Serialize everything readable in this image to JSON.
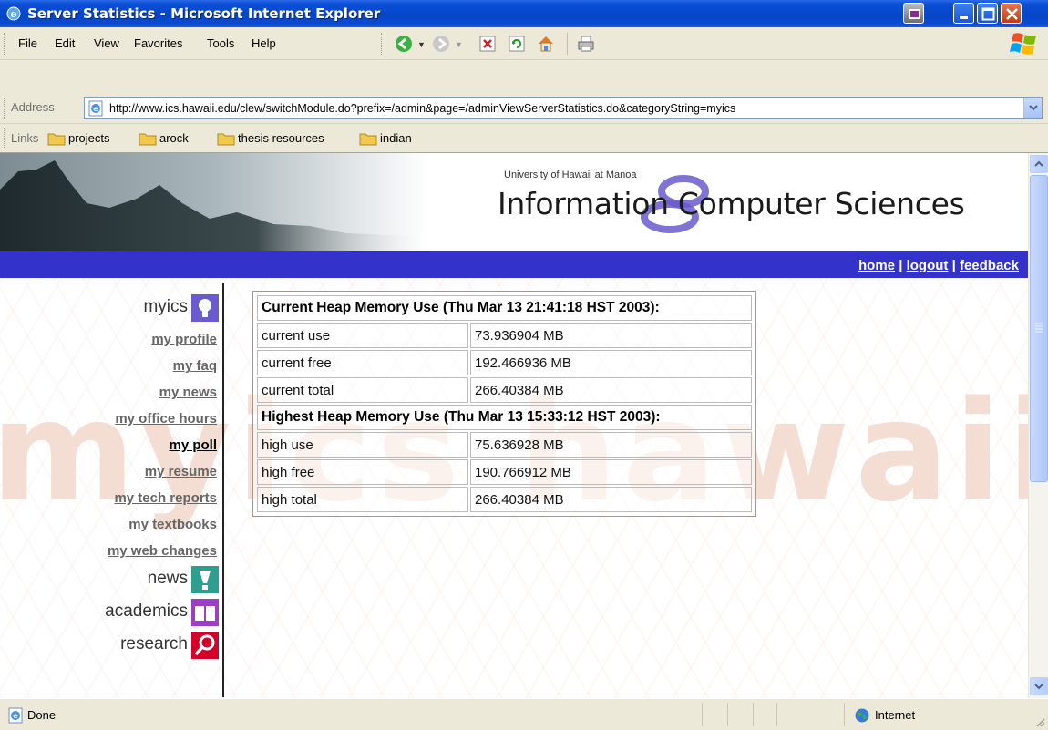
{
  "window": {
    "title": "Server Statistics - Microsoft Internet Explorer"
  },
  "menu": {
    "items": [
      "File",
      "Edit",
      "View",
      "Favorites",
      "Tools",
      "Help"
    ]
  },
  "toolbar": {
    "icons": [
      "back-icon",
      "forward-icon",
      "stop-icon",
      "refresh-icon",
      "home-icon",
      "print-icon"
    ]
  },
  "address": {
    "label": "Address",
    "url": "http://www.ics.hawaii.edu/clew/switchModule.do?prefix=/admin&page=/adminViewServerStatistics.do&categoryString=myics"
  },
  "links_bar": {
    "label": "Links",
    "items": [
      "projects",
      "arock",
      "thesis resources",
      "indian"
    ]
  },
  "banner": {
    "university": "University of Hawaii at Manoa",
    "department": "Information Computer Sciences"
  },
  "top_links": {
    "home": "home",
    "sep": "|",
    "logout": "logout",
    "feedback": "feedback"
  },
  "sidebar": {
    "myics": "myics",
    "links": [
      "my profile",
      "my faq",
      "my news",
      "my office hours",
      "my poll",
      "my resume",
      "my tech reports",
      "my textbooks",
      "my web changes"
    ],
    "active": "my poll",
    "news": "news",
    "academics": "academics",
    "research": "research",
    "watermark": "myics hawaii"
  },
  "stats": {
    "current_header": "Current Heap Memory Use (Thu Mar 13 21:41:18 HST 2003):",
    "current_rows": [
      {
        "label": "current use",
        "value": "73.936904 MB"
      },
      {
        "label": "current free",
        "value": "192.466936 MB"
      },
      {
        "label": "current total",
        "value": "266.40384 MB"
      }
    ],
    "highest_header": "Highest Heap Memory Use (Thu Mar 13 15:33:12 HST 2003):",
    "highest_rows": [
      {
        "label": "high use",
        "value": "75.636928 MB"
      },
      {
        "label": "high free",
        "value": "190.766912 MB"
      },
      {
        "label": "high total",
        "value": "266.40384 MB"
      }
    ]
  },
  "status": {
    "text": "Done",
    "zone": "Internet"
  },
  "colors": {
    "titlebar": "#0545c8",
    "navbar": "#3333cc",
    "accent_purple": "#6a5acd",
    "news_teal": "#2e9f8f",
    "academics_violet": "#9b3fc4",
    "research_red": "#d4002a"
  }
}
